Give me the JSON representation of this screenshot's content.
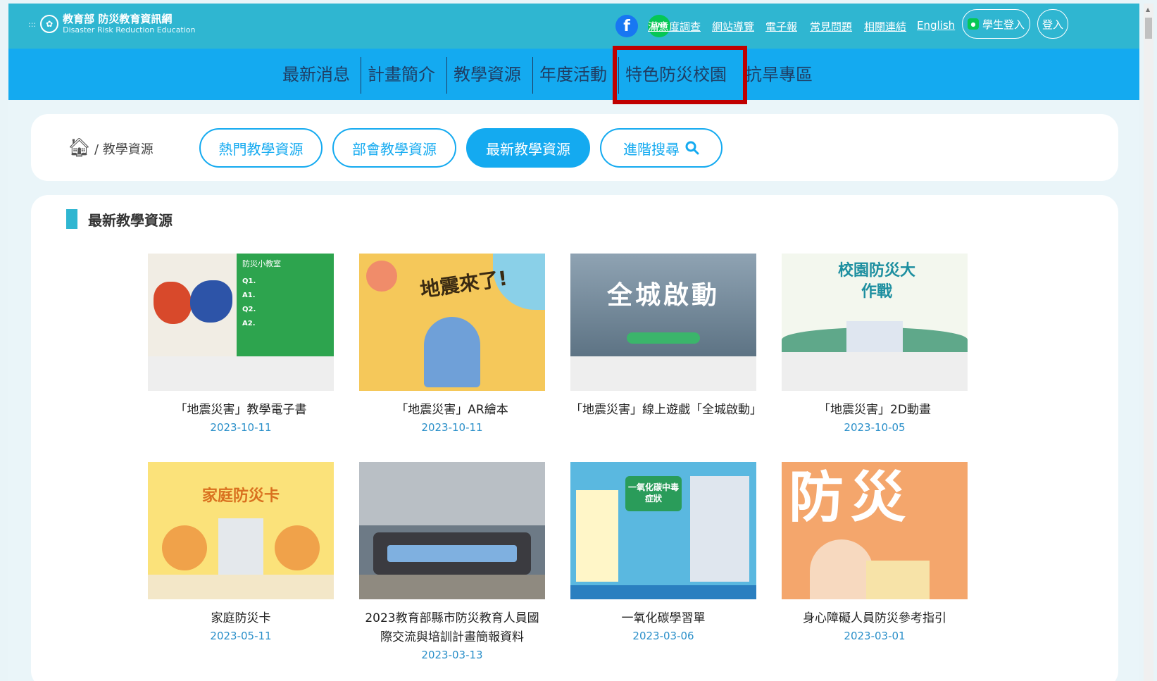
{
  "header": {
    "logo_zh": "教育部 防災教育資訊網",
    "logo_en": "Disaster Risk Reduction Education",
    "links": [
      "滿意度調查",
      "網站導覽",
      "電子報",
      "常見問題",
      "相關連結",
      "English"
    ],
    "student_login": "學生登入",
    "login": "登入",
    "fb_icon": "facebook-icon",
    "line_icon": "line-icon",
    "line_text": "LINE"
  },
  "nav": {
    "items": [
      "最新消息",
      "計畫簡介",
      "教學資源",
      "年度活動",
      "特色防災校園",
      "抗旱專區"
    ]
  },
  "breadcrumb": {
    "current": "教學資源"
  },
  "tabs": [
    "熱門教學資源",
    "部會教學資源",
    "最新教學資源",
    "進階搜尋"
  ],
  "section": {
    "title": "最新教學資源"
  },
  "cards": [
    {
      "title": "「地震災害」教學電子書",
      "date": "2023-10-11",
      "thumb_text": "防災小教室"
    },
    {
      "title": "「地震災害」AR繪本",
      "date": "2023-10-11",
      "thumb_text": "地震來了!"
    },
    {
      "title": "「地震災害」線上遊戲「全城啟動」",
      "date": "",
      "thumb_text": "全城啟動"
    },
    {
      "title": "「地震災害」2D動畫",
      "date": "2023-10-05",
      "thumb_text": "校園防災大作戰"
    },
    {
      "title": "家庭防災卡",
      "date": "2023-05-11",
      "thumb_text": "家庭防災卡"
    },
    {
      "title": "2023教育部縣市防災教育人員國際交流與培訓計畫簡報資料",
      "date": "2023-03-13",
      "thumb_text": ""
    },
    {
      "title": "一氧化碳學習單",
      "date": "2023-03-06",
      "thumb_text": "一氧化碳中毒症狀"
    },
    {
      "title": "身心障礙人員防災參考指引",
      "date": "2023-03-01",
      "thumb_text": "防災"
    }
  ],
  "colors": {
    "topbar": "#2fb6d1",
    "mainnav": "#14aaf0",
    "accent": "#14aaf0",
    "date": "#2a8fc9",
    "highlight": "#c00000"
  }
}
